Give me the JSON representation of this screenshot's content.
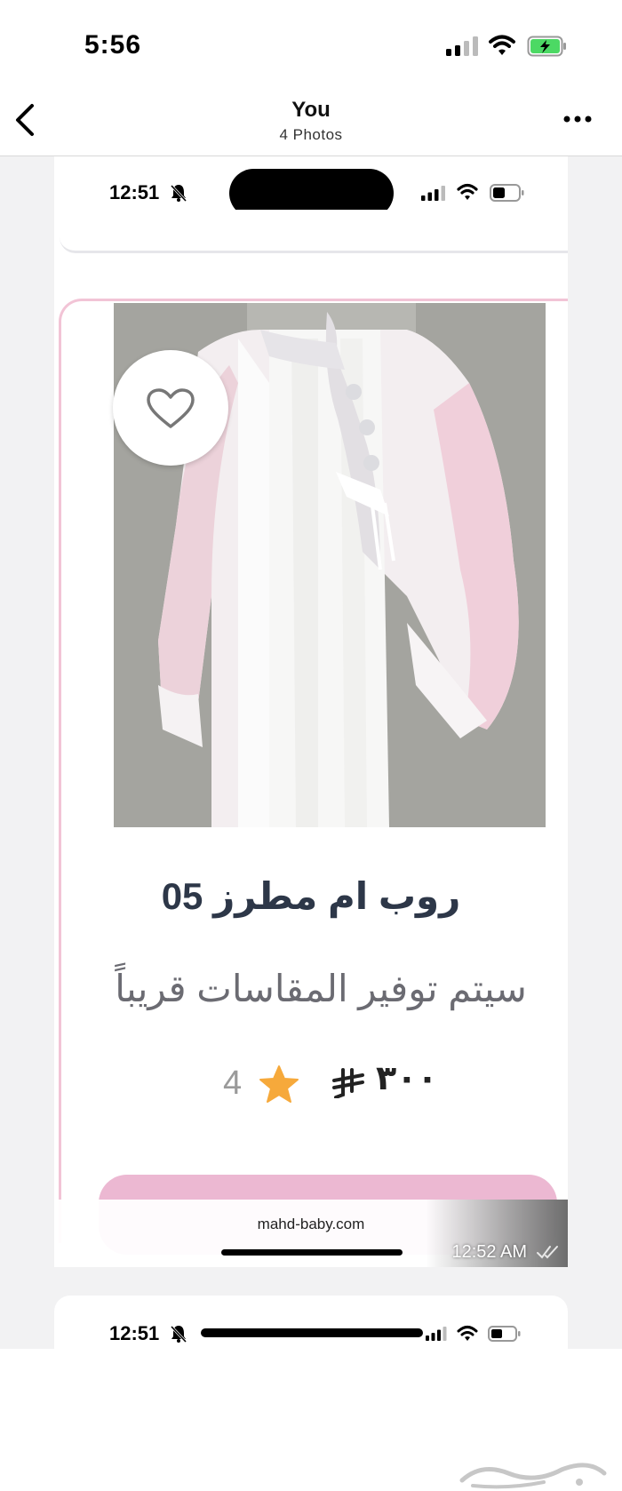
{
  "status_bar": {
    "time": "5:56",
    "icons": [
      "signal-icon",
      "wifi-icon",
      "battery-charging-icon"
    ],
    "battery_color": "#4cd964"
  },
  "nav": {
    "title": "You",
    "subtitle": "4 Photos",
    "icons": [
      "chevron-left-icon",
      "more-icon"
    ]
  },
  "screenshot": {
    "status": {
      "time": "12:51",
      "icons": [
        "bell-slash-icon",
        "signal-icon",
        "wifi-icon",
        "battery-icon"
      ]
    },
    "product": {
      "title": "روب ام مطرز 05",
      "subtitle": "سيتم توفير المقاسات قريباً",
      "price": "٣٠٠",
      "currency_icon": "riyal-icon",
      "rating": "4",
      "rating_icon": "star-icon",
      "favorite_icon": "heart-icon",
      "image_icon": "robe-photo",
      "accent_color": "#f2c4d6",
      "button_color": "#ecb8d2",
      "star_color": "#f6a93b"
    },
    "link": {
      "url": "mahd-baby.com",
      "message_time": "12:52 AM",
      "ticks_icon": "double-check-icon"
    }
  },
  "next_screenshot": {
    "time": "12:51"
  },
  "watermark": {
    "icon": "haraj-logo",
    "text": "حراج"
  }
}
